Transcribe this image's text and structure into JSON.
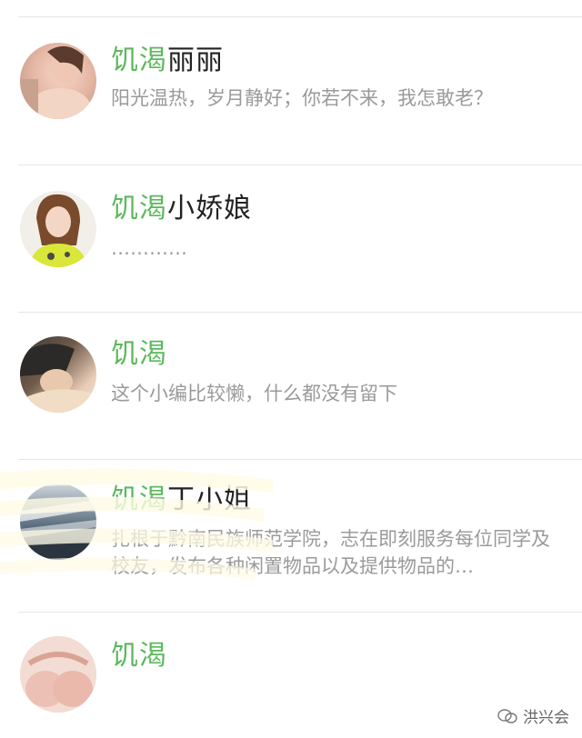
{
  "contacts": [
    {
      "prefix": "饥渴",
      "suffix": "丽丽",
      "description": "阳光温热，岁月静好；你若不来，我怎敢老？"
    },
    {
      "prefix": "饥渴",
      "suffix": "小娇娘",
      "description": "…………"
    },
    {
      "prefix": "饥渴",
      "suffix": "",
      "description": "这个小编比较懒，什么都没有留下"
    },
    {
      "prefix": "饥渴",
      "suffix": "丁小姐",
      "description": "扎根于黔南民族师范学院，志在即刻服务每位同学及校友，发布各种闲置物品以及提供物品的…"
    },
    {
      "prefix": "饥渴",
      "suffix": "",
      "description": ""
    }
  ],
  "watermark": {
    "text": "洪兴会"
  },
  "colors": {
    "accent": "#5cb85c",
    "divider": "#e6e6e6",
    "secondary_text": "#9a9a9a"
  }
}
